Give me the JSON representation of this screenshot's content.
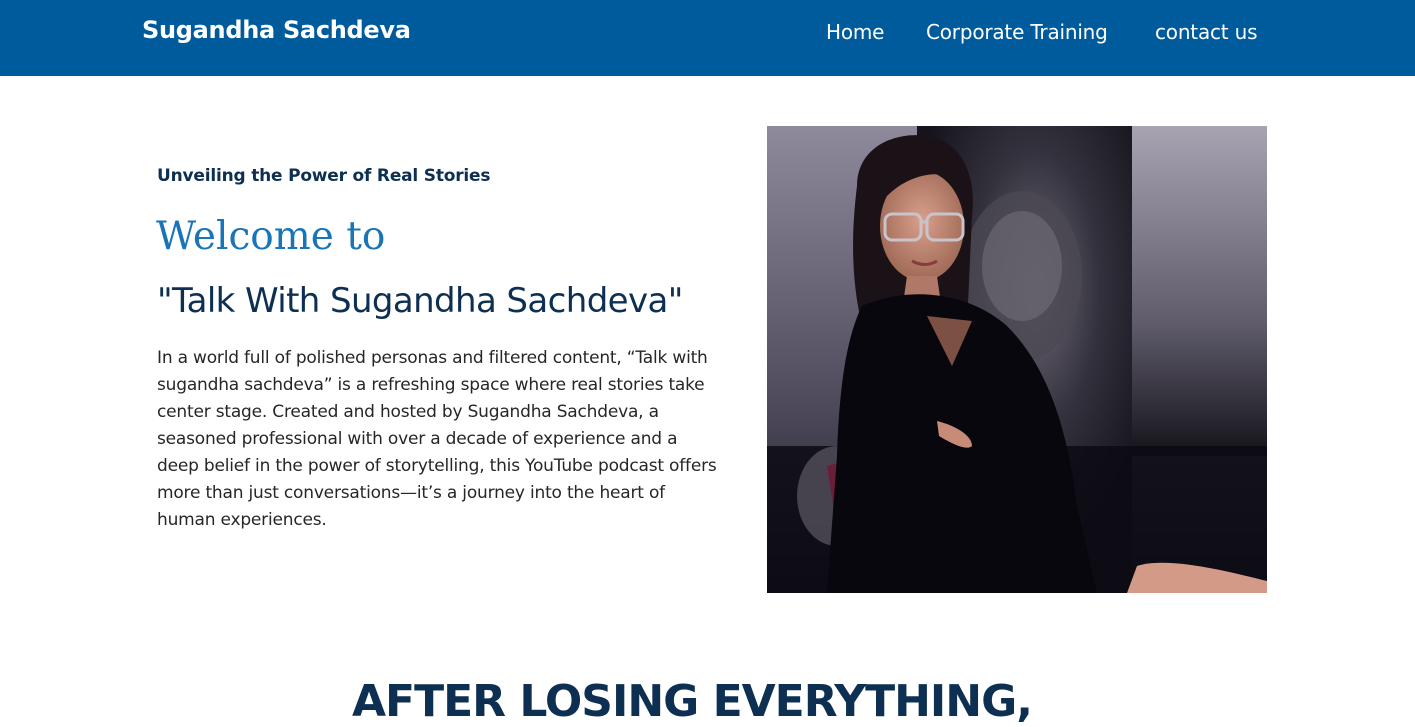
{
  "header": {
    "brand": "Sugandha Sachdeva",
    "nav": [
      {
        "label": "Home"
      },
      {
        "label": "Corporate Training"
      },
      {
        "label": "contact us"
      }
    ],
    "background_color": "#005b9c"
  },
  "hero": {
    "tagline": "Unveiling the Power of Real Stories",
    "welcome": "Welcome to",
    "show_title": "\"Talk With Sugandha Sachdeva\"",
    "intro": "In a world full of polished personas and filtered content, “Talk with sugandha sachdeva” is a refreshing space where real stories take center stage. Created and hosted by Sugandha Sachdeva, a seasoned professional with over a decade of experience and a deep belief in the power of storytelling, this YouTube podcast offers more than just conversations—it’s a journey into the heart of human experiences.",
    "photo": "host-portrait-photo"
  },
  "section": {
    "heading": "AFTER LOSING EVERYTHING,"
  },
  "colors": {
    "navy": "#0d2f52",
    "accent_blue": "#1a75b8",
    "body_text": "#262626"
  }
}
